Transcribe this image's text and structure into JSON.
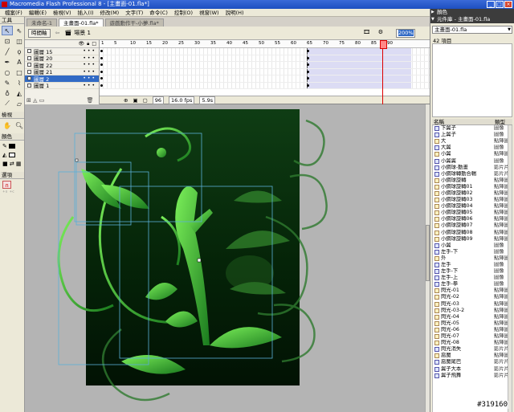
{
  "window": {
    "title": "Macromedia Flash Professional 8 - [主畫面-01.fla*]"
  },
  "menu": [
    "檔案(F)",
    "編輯(E)",
    "檢視(V)",
    "插入(I)",
    "修改(M)",
    "文字(T)",
    "命令(C)",
    "控制(O)",
    "視窗(W)",
    "說明(H)"
  ],
  "tools": {
    "title": "工具",
    "view_label": "檢視",
    "colors_label": "顏色",
    "options_label": "選項"
  },
  "doc_tabs": [
    {
      "label": "未命名-1",
      "active": false
    },
    {
      "label": "主畫面-01.fla*",
      "active": true
    },
    {
      "label": "遊戲動作干-小夢.fla*",
      "active": false
    }
  ],
  "editbar": {
    "timeline_button": "時間軸",
    "scene": "場景 1",
    "zoom": "200%"
  },
  "timeline": {
    "layers": [
      {
        "name": "圖層 15",
        "selected": false
      },
      {
        "name": "圖層 20",
        "selected": false
      },
      {
        "name": "圖層 22",
        "selected": false
      },
      {
        "name": "圖層 21",
        "selected": false
      },
      {
        "name": "圖層 2",
        "selected": true
      },
      {
        "name": "圖層 1",
        "selected": false
      }
    ],
    "ruler": [
      "1",
      "5",
      "10",
      "15",
      "20",
      "25",
      "30",
      "35",
      "40",
      "45",
      "50",
      "55",
      "60",
      "65",
      "70",
      "75",
      "80",
      "85",
      "90"
    ],
    "current_frame": "96",
    "fps": "16.0 fps",
    "elapsed": "5.9s"
  },
  "panels": {
    "color_title": "顏色",
    "library_title": "元件庫 - 主畫面-01.fla"
  },
  "library": {
    "selected_doc": "主畫面-01.fla",
    "count": "42 項目",
    "col_name": "名稱",
    "col_kind": "類型",
    "items": [
      {
        "name": "下翼子",
        "kind": "圖像",
        "bmp": false
      },
      {
        "name": "上翼子",
        "kind": "圖像",
        "bmp": false
      },
      {
        "name": "大",
        "kind": "點陣圖",
        "bmp": true
      },
      {
        "name": "大翼",
        "kind": "圖像",
        "bmp": false
      },
      {
        "name": "小翼",
        "kind": "點陣圖",
        "bmp": true
      },
      {
        "name": "小翼翼",
        "kind": "圖像",
        "bmp": false
      },
      {
        "name": "小鋼球-動畫",
        "kind": "影片片段",
        "bmp": false
      },
      {
        "name": "小鋼球轉動合輯",
        "kind": "影片片段",
        "bmp": false
      },
      {
        "name": "小鋼球旋轉",
        "kind": "點陣圖",
        "bmp": true
      },
      {
        "name": "小鋼球旋轉01",
        "kind": "點陣圖",
        "bmp": true
      },
      {
        "name": "小鋼球旋轉02",
        "kind": "點陣圖",
        "bmp": true
      },
      {
        "name": "小鋼球旋轉03",
        "kind": "點陣圖",
        "bmp": true
      },
      {
        "name": "小鋼球旋轉04",
        "kind": "點陣圖",
        "bmp": true
      },
      {
        "name": "小鋼球旋轉05",
        "kind": "點陣圖",
        "bmp": true
      },
      {
        "name": "小鋼球旋轉06",
        "kind": "點陣圖",
        "bmp": true
      },
      {
        "name": "小鋼球旋轉07",
        "kind": "點陣圖",
        "bmp": true
      },
      {
        "name": "小鋼球旋轉08",
        "kind": "點陣圖",
        "bmp": true
      },
      {
        "name": "小鋼球旋轉09",
        "kind": "點陣圖",
        "bmp": true
      },
      {
        "name": "小翼",
        "kind": "圖像",
        "bmp": false
      },
      {
        "name": "左手-下",
        "kind": "圖像",
        "bmp": false
      },
      {
        "name": "外",
        "kind": "點陣圖",
        "bmp": true
      },
      {
        "name": "左手",
        "kind": "圖像",
        "bmp": false
      },
      {
        "name": "左手-下",
        "kind": "圖像",
        "bmp": false
      },
      {
        "name": "左手-上",
        "kind": "圖像",
        "bmp": false
      },
      {
        "name": "左手-拳",
        "kind": "圖像",
        "bmp": false
      },
      {
        "name": "閃光-01",
        "kind": "點陣圖",
        "bmp": true
      },
      {
        "name": "閃光-02",
        "kind": "點陣圖",
        "bmp": true
      },
      {
        "name": "閃光-03",
        "kind": "點陣圖",
        "bmp": true
      },
      {
        "name": "閃光-03-2",
        "kind": "點陣圖",
        "bmp": true
      },
      {
        "name": "閃光-04",
        "kind": "點陣圖",
        "bmp": true
      },
      {
        "name": "閃光-05",
        "kind": "點陣圖",
        "bmp": true
      },
      {
        "name": "閃光-06",
        "kind": "點陣圖",
        "bmp": true
      },
      {
        "name": "閃光-07",
        "kind": "點陣圖",
        "bmp": true
      },
      {
        "name": "閃光-08",
        "kind": "點陣圖",
        "bmp": true
      },
      {
        "name": "閃光消失",
        "kind": "影片片段",
        "bmp": false
      },
      {
        "name": "惡魔",
        "kind": "點陣圖",
        "bmp": true
      },
      {
        "name": "惡魔尾巴",
        "kind": "影片片段",
        "bmp": false
      },
      {
        "name": "翼子大本",
        "kind": "影片片段",
        "bmp": false
      },
      {
        "name": "翼子飛舞",
        "kind": "影片片段",
        "bmp": false
      }
    ]
  },
  "watermark": "#319160"
}
